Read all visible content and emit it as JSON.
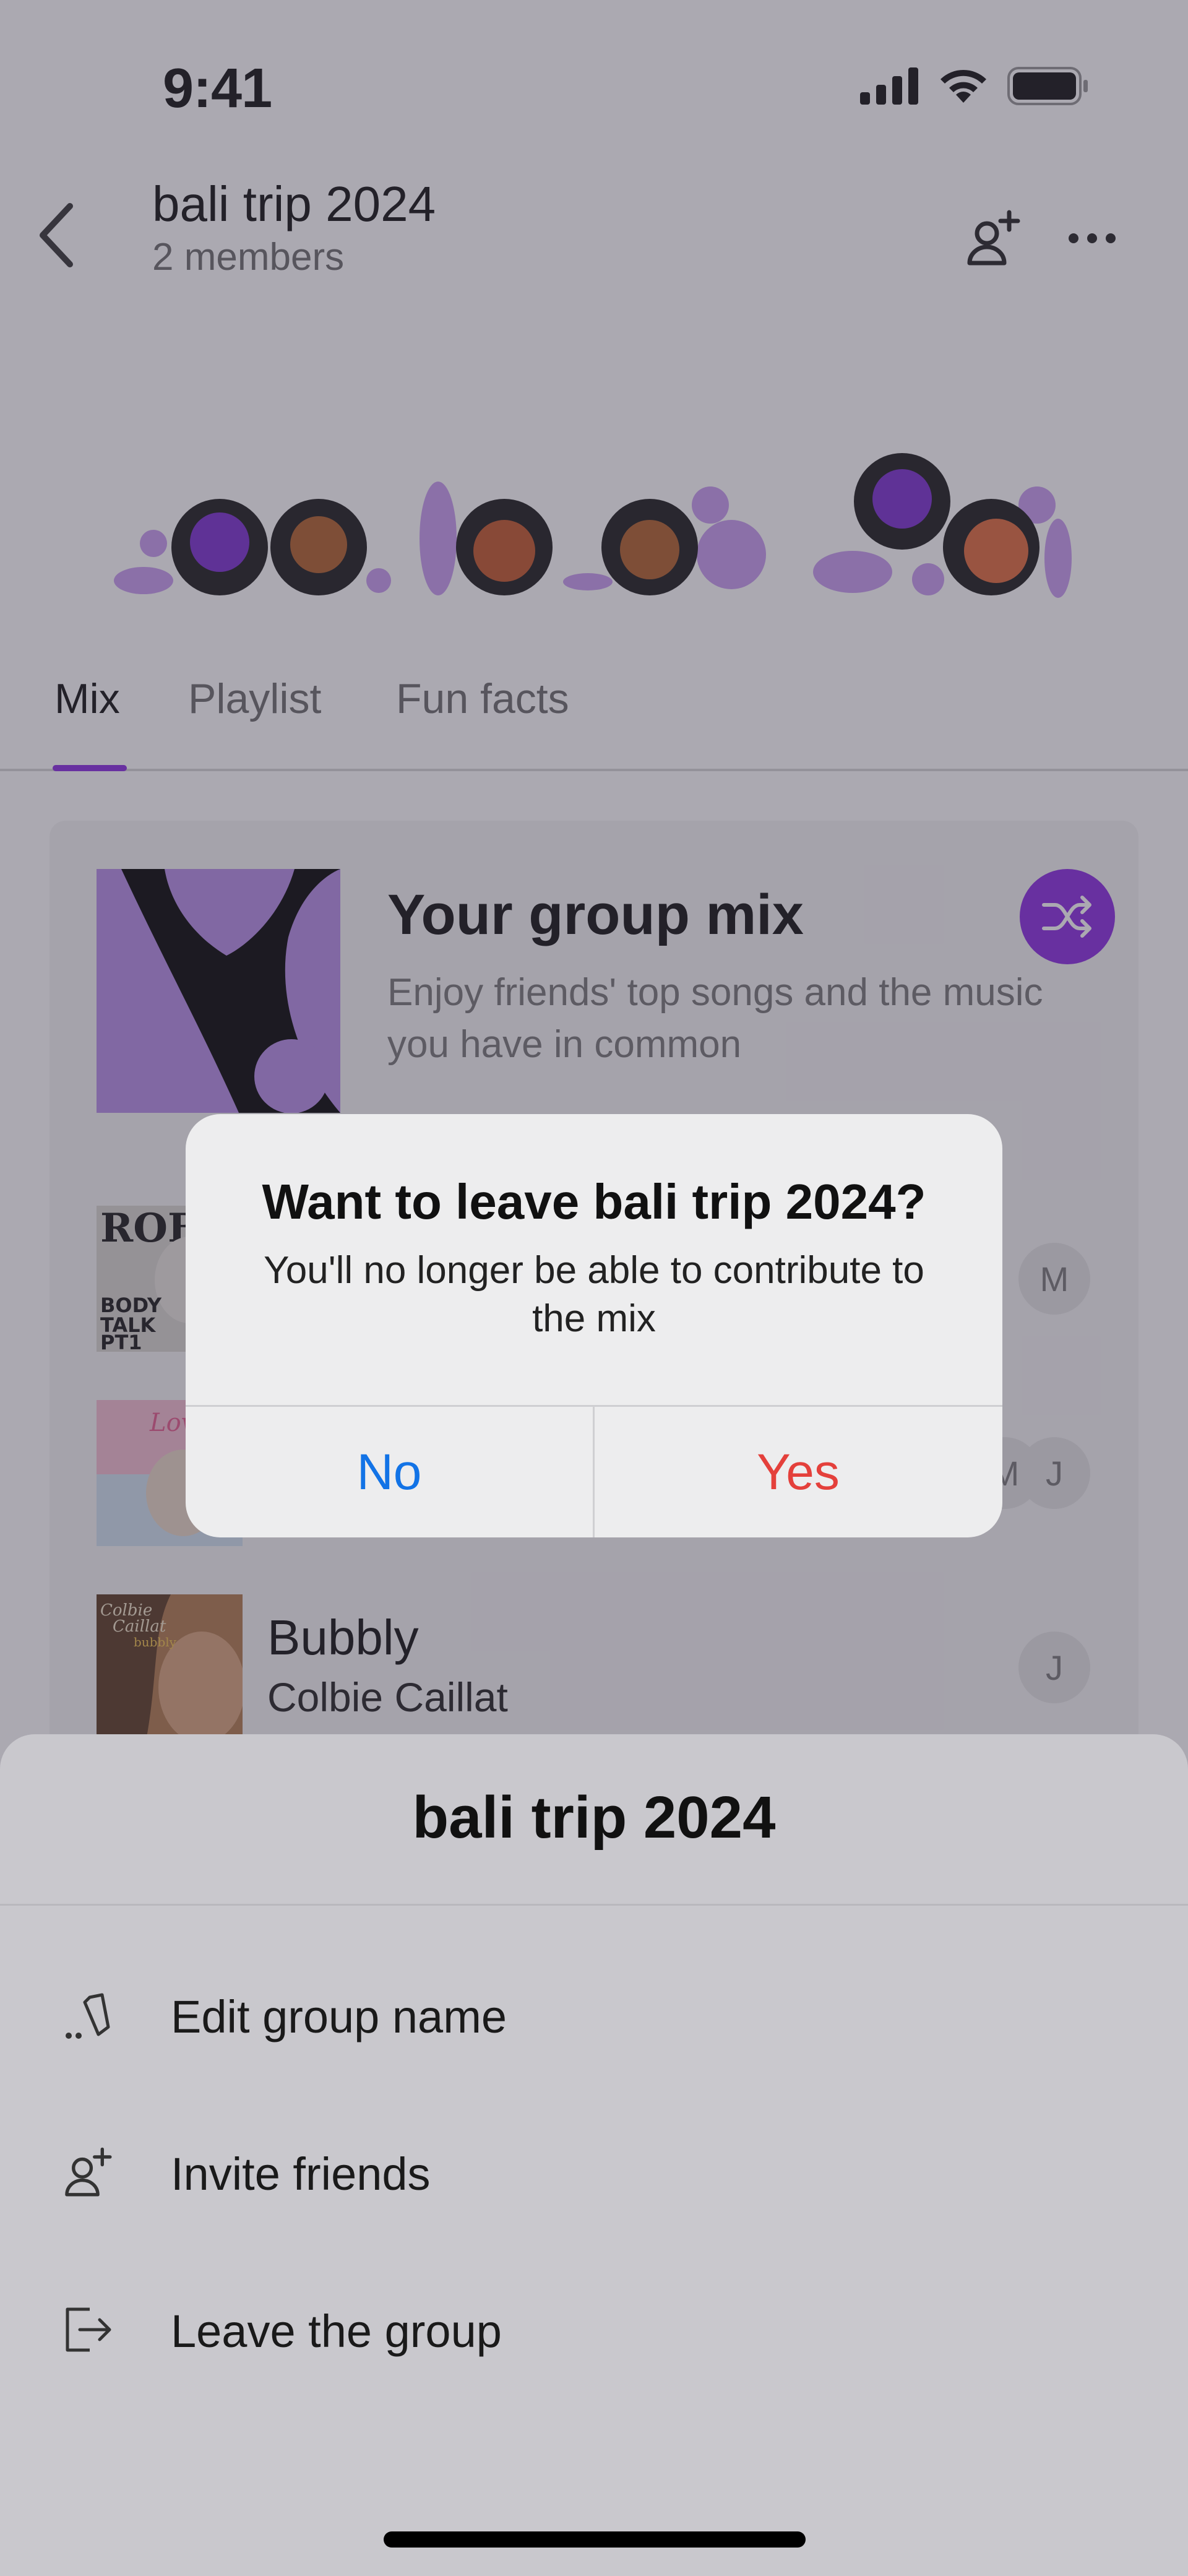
{
  "status_bar": {
    "time": "9:41"
  },
  "header": {
    "title": "bali trip 2024",
    "subtitle": "2 members"
  },
  "tabs": [
    {
      "label": "Mix",
      "active": true
    },
    {
      "label": "Playlist",
      "active": false
    },
    {
      "label": "Fun facts",
      "active": false
    }
  ],
  "mix": {
    "title": "Your group mix",
    "description": "Enjoy friends' top songs and the music you have in common"
  },
  "songs": [
    {
      "title": "",
      "artist": "",
      "members": [
        "M"
      ]
    },
    {
      "title": "",
      "artist": "",
      "members": [
        "M",
        "J"
      ]
    },
    {
      "title": "Bubbly",
      "artist": "Colbie Caillat",
      "members": [
        "J"
      ]
    }
  ],
  "sheet": {
    "title": "bali trip 2024",
    "items": [
      {
        "label": "Edit group name",
        "icon": "pencil-icon"
      },
      {
        "label": "Invite friends",
        "icon": "person-add-icon"
      },
      {
        "label": "Leave the group",
        "icon": "exit-icon"
      }
    ]
  },
  "alert": {
    "title": "Want to leave bali trip 2024?",
    "message": "You'll no longer be able to contribute to the mix",
    "no_label": "No",
    "yes_label": "Yes"
  },
  "colors": {
    "accent": "#8a2be2",
    "alert_no": "#1273e6",
    "alert_yes": "#e4403b"
  }
}
